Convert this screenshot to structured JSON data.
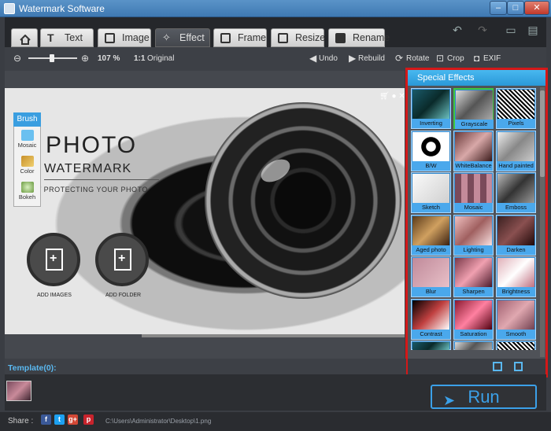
{
  "window": {
    "title": "Watermark Software"
  },
  "tabs": [
    {
      "id": "home",
      "label": ""
    },
    {
      "id": "text",
      "label": "Text"
    },
    {
      "id": "image",
      "label": "Image"
    },
    {
      "id": "effect",
      "label": "Effect",
      "active": true
    },
    {
      "id": "frame",
      "label": "Frame"
    },
    {
      "id": "resize",
      "label": "Resize"
    },
    {
      "id": "rename",
      "label": "Rename"
    }
  ],
  "toolbar": {
    "zoom": "107 %",
    "original": "Original",
    "original_icon": "1:1",
    "undo": "Undo",
    "rebuild": "Rebuild",
    "rotate": "Rotate",
    "crop": "Crop",
    "exif": "EXIF"
  },
  "photo": {
    "title": "PHOTO",
    "subtitle": "WATERMARK",
    "tagline": "RT PROTECTING YOUR PHOTO",
    "add_images": "ADD IMAGES",
    "add_folder": "ADD FOLDER"
  },
  "brush": {
    "title": "Brush",
    "items": [
      "Mosaic",
      "Color",
      "Bokeh"
    ]
  },
  "effects": {
    "title": "Special Effects",
    "selected": "Grayscale",
    "items": [
      "Inverting",
      "Grayscale",
      "Pixels",
      "B/W",
      "WhiteBalance",
      "Hand painted",
      "Sketch",
      "Mosaic",
      "Emboss",
      "Aged photo",
      "Lighting",
      "Darken",
      "Blur",
      "Sharpen",
      "Brightness",
      "Contrast",
      "Saturation",
      "Smooth"
    ]
  },
  "template": {
    "label": "Template(0):"
  },
  "run": {
    "label": "Run"
  },
  "status": {
    "share": "Share :",
    "path": "C:\\Users\\Administrator\\Desktop\\1.png"
  },
  "colors": {
    "accent": "#3ba0e8",
    "highlight_border": "#d41818",
    "panel_header": "#2a98d8"
  }
}
